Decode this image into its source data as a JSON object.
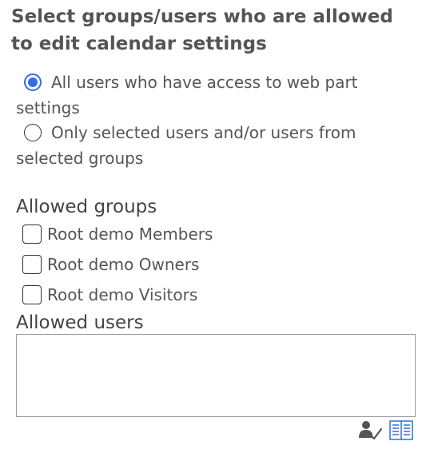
{
  "heading": "Select groups/users who are allowed to edit calendar settings",
  "permission_options": [
    {
      "label": "All users who have access to web part settings",
      "selected": true
    },
    {
      "label": "Only selected users and/or users from selected groups",
      "selected": false
    }
  ],
  "allowed_groups": {
    "label": "Allowed groups",
    "groups": [
      {
        "label": "Root demo Members",
        "checked": false
      },
      {
        "label": "Root demo Owners",
        "checked": false
      },
      {
        "label": "Root demo Visitors",
        "checked": false
      }
    ]
  },
  "allowed_users": {
    "label": "Allowed users",
    "value": ""
  },
  "icons": {
    "check_names": "check-names-icon",
    "browse": "address-book-icon"
  },
  "colors": {
    "radio_selected": "#2f6fe4",
    "text": "#555555",
    "browse_icon": "#3a7bd5",
    "check_icon": "#555555"
  }
}
